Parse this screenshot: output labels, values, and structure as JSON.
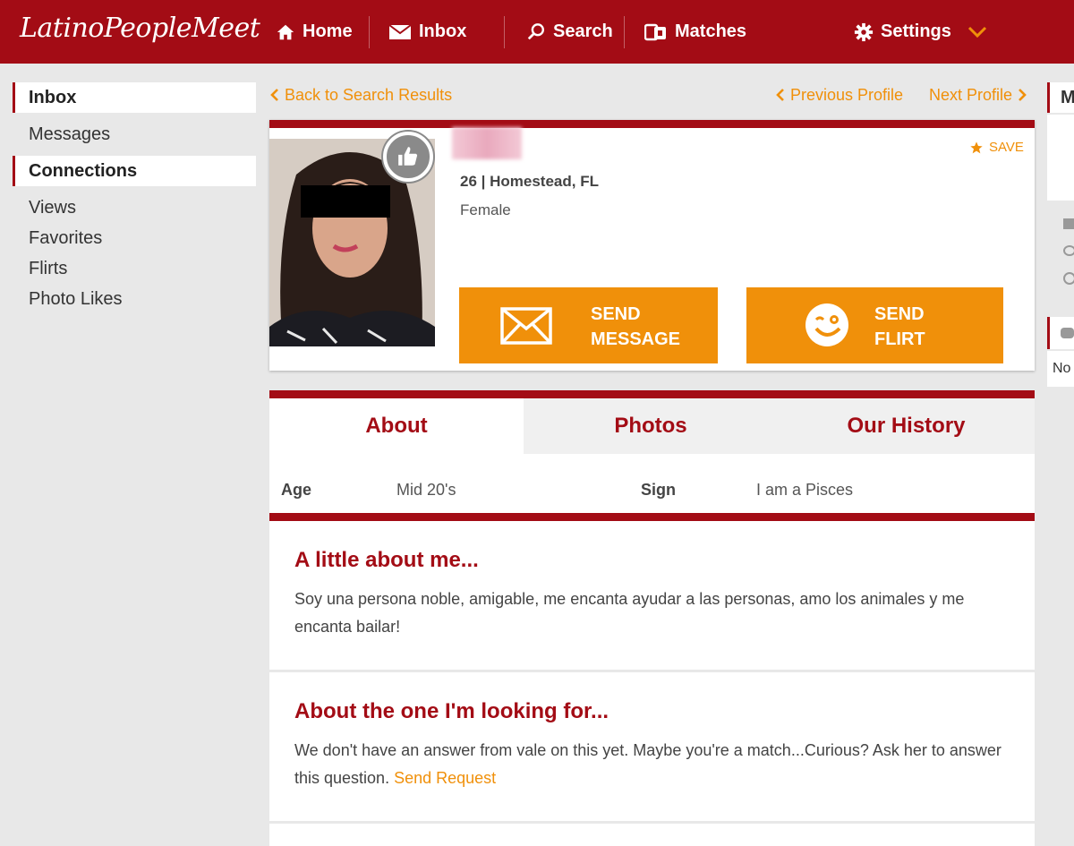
{
  "brand": {
    "logo": "LatinoPeopleMeet",
    "accent": "#a30c15",
    "action": "#f0900a"
  },
  "nav": {
    "home": "Home",
    "inbox": "Inbox",
    "search": "Search",
    "matches": "Matches",
    "settings": "Settings"
  },
  "sidebar": {
    "inbox_head": "Inbox",
    "messages": "Messages",
    "connections_head": "Connections",
    "views": "Views",
    "favorites": "Favorites",
    "flirts": "Flirts",
    "photo_likes": "Photo Likes"
  },
  "pager": {
    "back": "Back to Search Results",
    "previous": "Previous Profile",
    "next": "Next Profile"
  },
  "profile": {
    "age_location": "26 | Homestead, FL",
    "gender": "Female",
    "save": "SAVE",
    "send_message": [
      "SEND",
      "MESSAGE"
    ],
    "send_flirt": [
      "SEND",
      "FLIRT"
    ]
  },
  "tabs": [
    "About",
    "Photos",
    "Our History"
  ],
  "attributes": {
    "age_label": "Age",
    "age_value": "Mid 20's",
    "sign_label": "Sign",
    "sign_value": "I am a Pisces"
  },
  "about_me": {
    "title": "A little about me...",
    "text": "Soy una persona noble, amigable, me encanta ayudar a las personas, amo los animales y me encanta bailar!"
  },
  "looking_for": {
    "title": "About the one I'm looking for...",
    "text": "We don't have an answer from vale on this yet. Maybe you're a match...Curious? Ask her to answer this question.",
    "link": "Send Request"
  },
  "right_col": {
    "head": "M",
    "no": "No"
  }
}
